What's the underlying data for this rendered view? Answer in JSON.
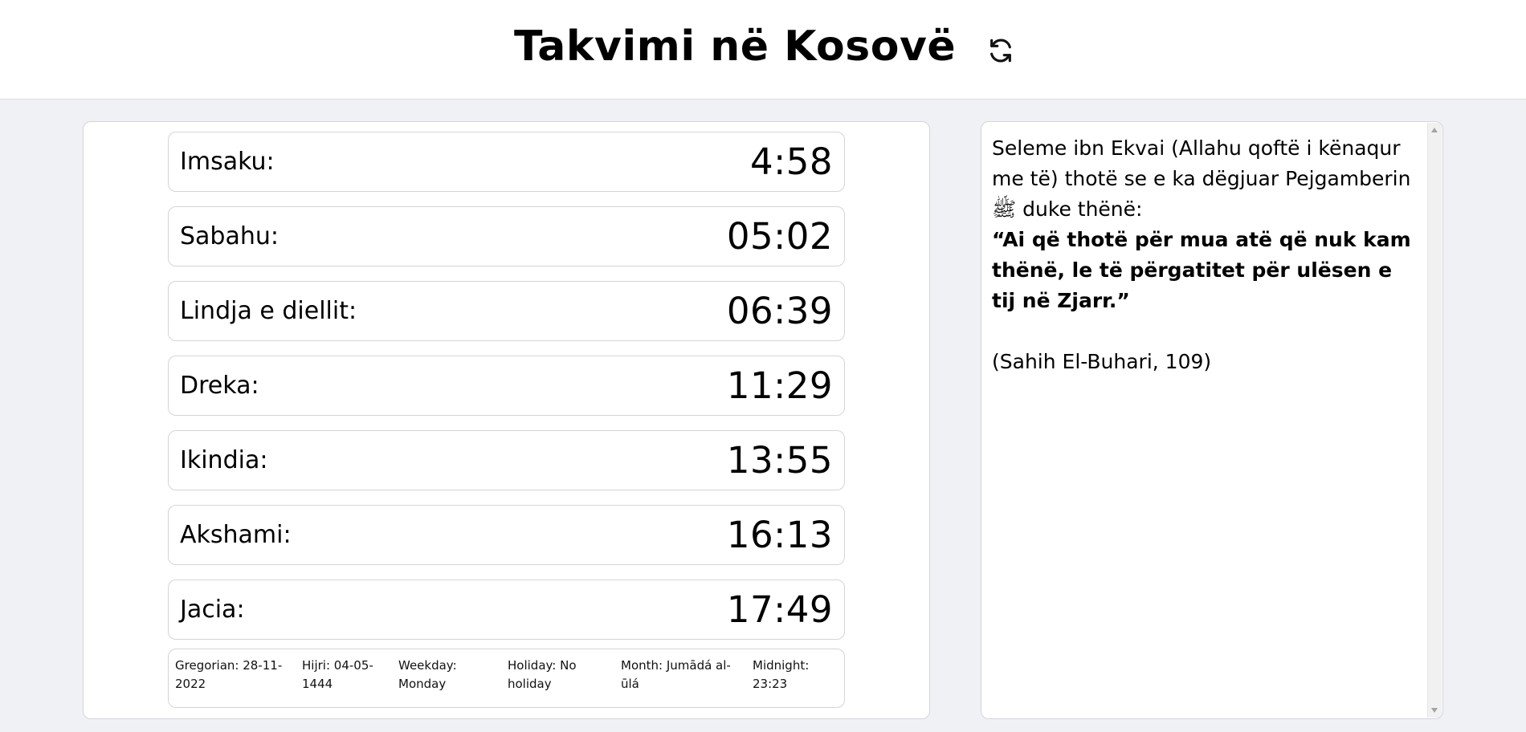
{
  "header": {
    "title": "Takvimi në Kosovë",
    "refresh_icon": "refresh-icon"
  },
  "prayers": [
    {
      "label": "Imsaku:",
      "time": "4:58"
    },
    {
      "label": "Sabahu:",
      "time": "05:02"
    },
    {
      "label": "Lindja e diellit:",
      "time": "06:39"
    },
    {
      "label": "Dreka:",
      "time": "11:29"
    },
    {
      "label": "Ikindia:",
      "time": "13:55"
    },
    {
      "label": "Akshami:",
      "time": "16:13"
    },
    {
      "label": "Jacia:",
      "time": "17:49"
    }
  ],
  "info": {
    "gregorian": "Gregorian: 28-11-2022",
    "hijri": "Hijri: 04-05-1444",
    "weekday": "Weekday: Monday",
    "holiday": "Holiday: No holiday",
    "month": "Month: Jumādá al-ūlá",
    "midnight": "Midnight: 23:23"
  },
  "hadith": {
    "intro": "Seleme ibn Ekvai (Allahu qoftë i kënaqur me të) thotë se e ka dëgjuar Pejgamberin ﷺ duke thënë:",
    "quote": "“Ai që thotë për mua atë që nuk kam thënë, le të përgatitet për ulësen e tij në Zjarr.”",
    "source": "(Sahih El-Buhari, 109)"
  }
}
